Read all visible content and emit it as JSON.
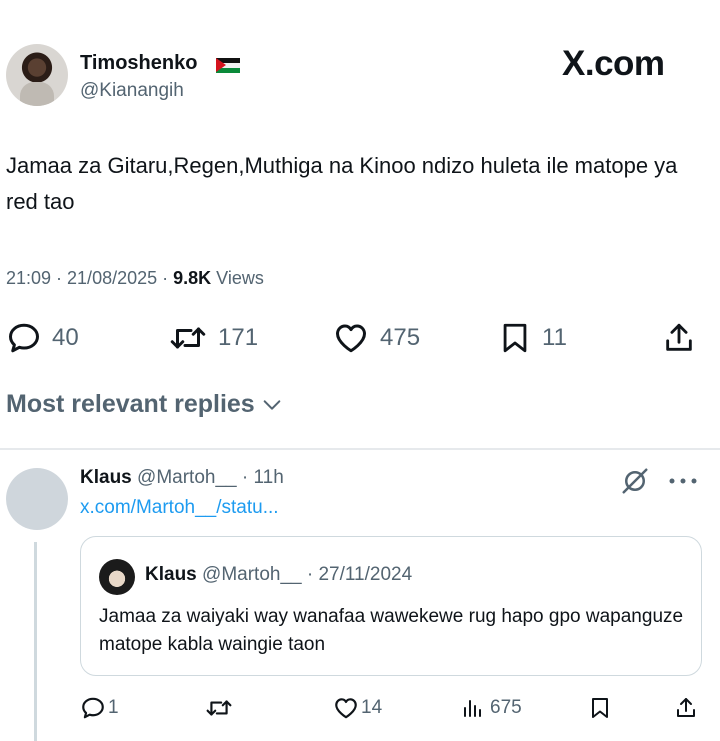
{
  "post": {
    "author_name": "Timoshenko",
    "author_handle": "@Kianangih",
    "brand": "X.com",
    "text": "Jamaa za Gitaru,Regen,Muthiga na Kinoo ndizo huleta ile matope ya red tao",
    "meta": {
      "timestamp": "21:09 · 21/08/2025 · ",
      "views_count": "9.8K",
      "views_label": " Views"
    },
    "stats": {
      "replies": "40",
      "reposts": "171",
      "likes": "475",
      "bookmarks": "11"
    }
  },
  "replies_filter": {
    "label": "Most relevant replies"
  },
  "reply": {
    "author_name": "Klaus",
    "author_handle": "@Martoh__ · 11h",
    "link_text": "x.com/Martoh__/statu...",
    "quote": {
      "author_name": "Klaus",
      "author_handle": "@Martoh__ · 27/11/2024",
      "text": "Jamaa za waiyaki way wanafaa wawekewe rug hapo gpo wapanguze matope kabla waingie taon"
    },
    "stats": {
      "replies": "1",
      "likes": "14",
      "views": "675"
    }
  },
  "icons": {
    "reply": "reply-bubble-icon",
    "repost": "repost-icon",
    "like": "heart-icon",
    "bookmark": "bookmark-icon",
    "share": "share-icon",
    "views": "analytics-icon",
    "grok": "grok-icon",
    "more": "more-dots-icon",
    "chevron": "chevron-down-icon",
    "flag": "palestine-flag-icon"
  },
  "colors": {
    "text_primary": "#0f1419",
    "text_secondary": "#536471",
    "link": "#1d9bf0",
    "border": "#cfd9de"
  }
}
